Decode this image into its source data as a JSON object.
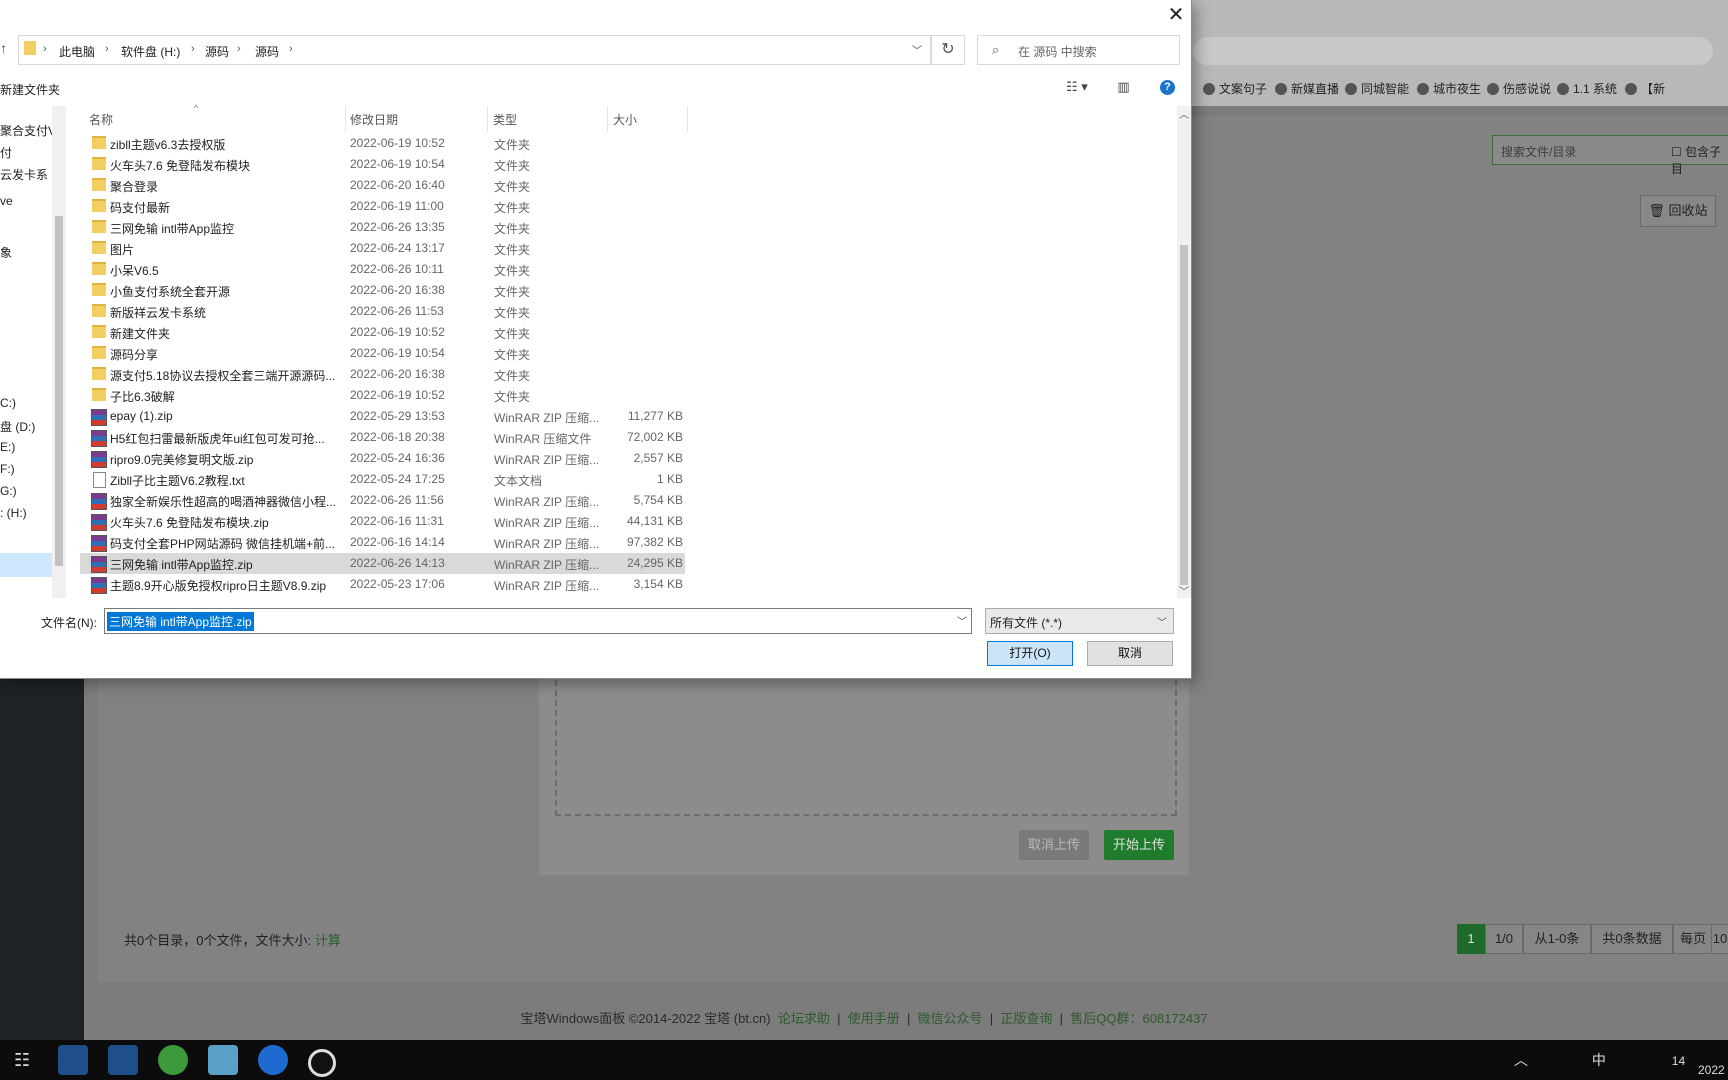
{
  "browser": {
    "bookmarks": [
      "文案句子",
      "新媒直播",
      "同城智能",
      "城市夜生",
      "伤感说说",
      "1.1 系统",
      "【新"
    ]
  },
  "panel": {
    "search_placeholder": "搜索文件/目录",
    "include_sub": "包含子目",
    "recycle_label": "回收站",
    "status_prefix": "共0个目录，0个文件，文件大小:",
    "status_calc": "计算",
    "pager": {
      "current": "1",
      "pages": "1/0",
      "range": "从1-0条",
      "total": "共0条数据",
      "per_page": "每页",
      "per_page_value": "10"
    },
    "upload": {
      "cancel_label": "取消上传",
      "start_label": "开始上传"
    },
    "footer": {
      "copyright": "宝塔Windows面板 ©2014-2022 宝塔 (bt.cn)",
      "links": [
        "论坛求助",
        "使用手册",
        "微信公众号",
        "正版查询"
      ],
      "qq": "售后QQ群：608172437"
    }
  },
  "dialog": {
    "breadcrumb": [
      "此电脑",
      "软件盘 (H:)",
      "源码",
      "源码"
    ],
    "search_placeholder": "在 源码 中搜索",
    "new_folder_label": "新建文件夹",
    "nav_items": [
      "聚合支付V",
      "付",
      "云发卡系",
      "ve",
      "象",
      "C:)",
      "盘 (D:)",
      "E:)",
      "F:)",
      "G:)",
      ": (H:)"
    ],
    "columns": {
      "name": "名称",
      "date": "修改日期",
      "type": "类型",
      "size": "大小"
    },
    "files": [
      {
        "name": "zibll主题v6.3去授权版",
        "date": "2022-06-19 10:52",
        "type": "文件夹",
        "size": "",
        "icon": "folder-icon"
      },
      {
        "name": "火车头7.6 免登陆发布模块",
        "date": "2022-06-19 10:54",
        "type": "文件夹",
        "size": "",
        "icon": "folder-icon"
      },
      {
        "name": "聚合登录",
        "date": "2022-06-20 16:40",
        "type": "文件夹",
        "size": "",
        "icon": "folder-icon"
      },
      {
        "name": "码支付最新",
        "date": "2022-06-19 11:00",
        "type": "文件夹",
        "size": "",
        "icon": "folder-icon"
      },
      {
        "name": "三网免输 intl带App监控",
        "date": "2022-06-26 13:35",
        "type": "文件夹",
        "size": "",
        "icon": "folder-icon"
      },
      {
        "name": "图片",
        "date": "2022-06-24 13:17",
        "type": "文件夹",
        "size": "",
        "icon": "folder-icon"
      },
      {
        "name": "小呆V6.5",
        "date": "2022-06-26 10:11",
        "type": "文件夹",
        "size": "",
        "icon": "folder-icon"
      },
      {
        "name": "小鱼支付系统全套开源",
        "date": "2022-06-20 16:38",
        "type": "文件夹",
        "size": "",
        "icon": "folder-icon"
      },
      {
        "name": "新版祥云发卡系统",
        "date": "2022-06-26 11:53",
        "type": "文件夹",
        "size": "",
        "icon": "folder-icon"
      },
      {
        "name": "新建文件夹",
        "date": "2022-06-19 10:52",
        "type": "文件夹",
        "size": "",
        "icon": "folder-icon"
      },
      {
        "name": "源码分享",
        "date": "2022-06-19 10:54",
        "type": "文件夹",
        "size": "",
        "icon": "folder-icon"
      },
      {
        "name": "源支付5.18协议去授权全套三端开源源码...",
        "date": "2022-06-20 16:38",
        "type": "文件夹",
        "size": "",
        "icon": "folder-icon"
      },
      {
        "name": "子比6.3破解",
        "date": "2022-06-19 10:52",
        "type": "文件夹",
        "size": "",
        "icon": "folder-icon"
      },
      {
        "name": "epay (1).zip",
        "date": "2022-05-29 13:53",
        "type": "WinRAR ZIP 压缩...",
        "size": "11,277 KB",
        "icon": "winrar-zip-icon"
      },
      {
        "name": "H5红包扫雷最新版虎年ui红包可发可抢...",
        "date": "2022-06-18 20:38",
        "type": "WinRAR 压缩文件",
        "size": "72,002 KB",
        "icon": "winrar-zip-icon"
      },
      {
        "name": "ripro9.0完美修复明文版.zip",
        "date": "2022-05-24 16:36",
        "type": "WinRAR ZIP 压缩...",
        "size": "2,557 KB",
        "icon": "winrar-zip-icon"
      },
      {
        "name": "Zibll子比主题V6.2教程.txt",
        "date": "2022-05-24 17:25",
        "type": "文本文档",
        "size": "1 KB",
        "icon": "text-file-icon"
      },
      {
        "name": "独家全新娱乐性超高的喝酒神器微信小程...",
        "date": "2022-06-26 11:56",
        "type": "WinRAR ZIP 压缩...",
        "size": "5,754 KB",
        "icon": "winrar-zip-icon"
      },
      {
        "name": "火车头7.6 免登陆发布模块.zip",
        "date": "2022-06-16 11:31",
        "type": "WinRAR ZIP 压缩...",
        "size": "44,131 KB",
        "icon": "winrar-zip-icon"
      },
      {
        "name": "码支付全套PHP网站源码 微信挂机端+前...",
        "date": "2022-06-16 14:14",
        "type": "WinRAR ZIP 压缩...",
        "size": "97,382 KB",
        "icon": "winrar-zip-icon"
      },
      {
        "name": "三网免输 intl带App监控.zip",
        "date": "2022-06-26 14:13",
        "type": "WinRAR ZIP 压缩...",
        "size": "24,295 KB",
        "icon": "winrar-zip-icon",
        "selected": true
      },
      {
        "name": "主题8.9开心版免授权ripro日主题V8.9.zip",
        "date": "2022-05-23 17:06",
        "type": "WinRAR ZIP 压缩...",
        "size": "3,154 KB",
        "icon": "winrar-zip-icon"
      }
    ],
    "filename_label": "文件名(N):",
    "filename_value": "三网免输 intl带App监控.zip",
    "filter_value": "所有文件 (*.*)",
    "open_label": "打开(O)",
    "cancel_label": "取消"
  },
  "tray": {
    "ime": "中",
    "time": "14",
    "date": "2022"
  }
}
